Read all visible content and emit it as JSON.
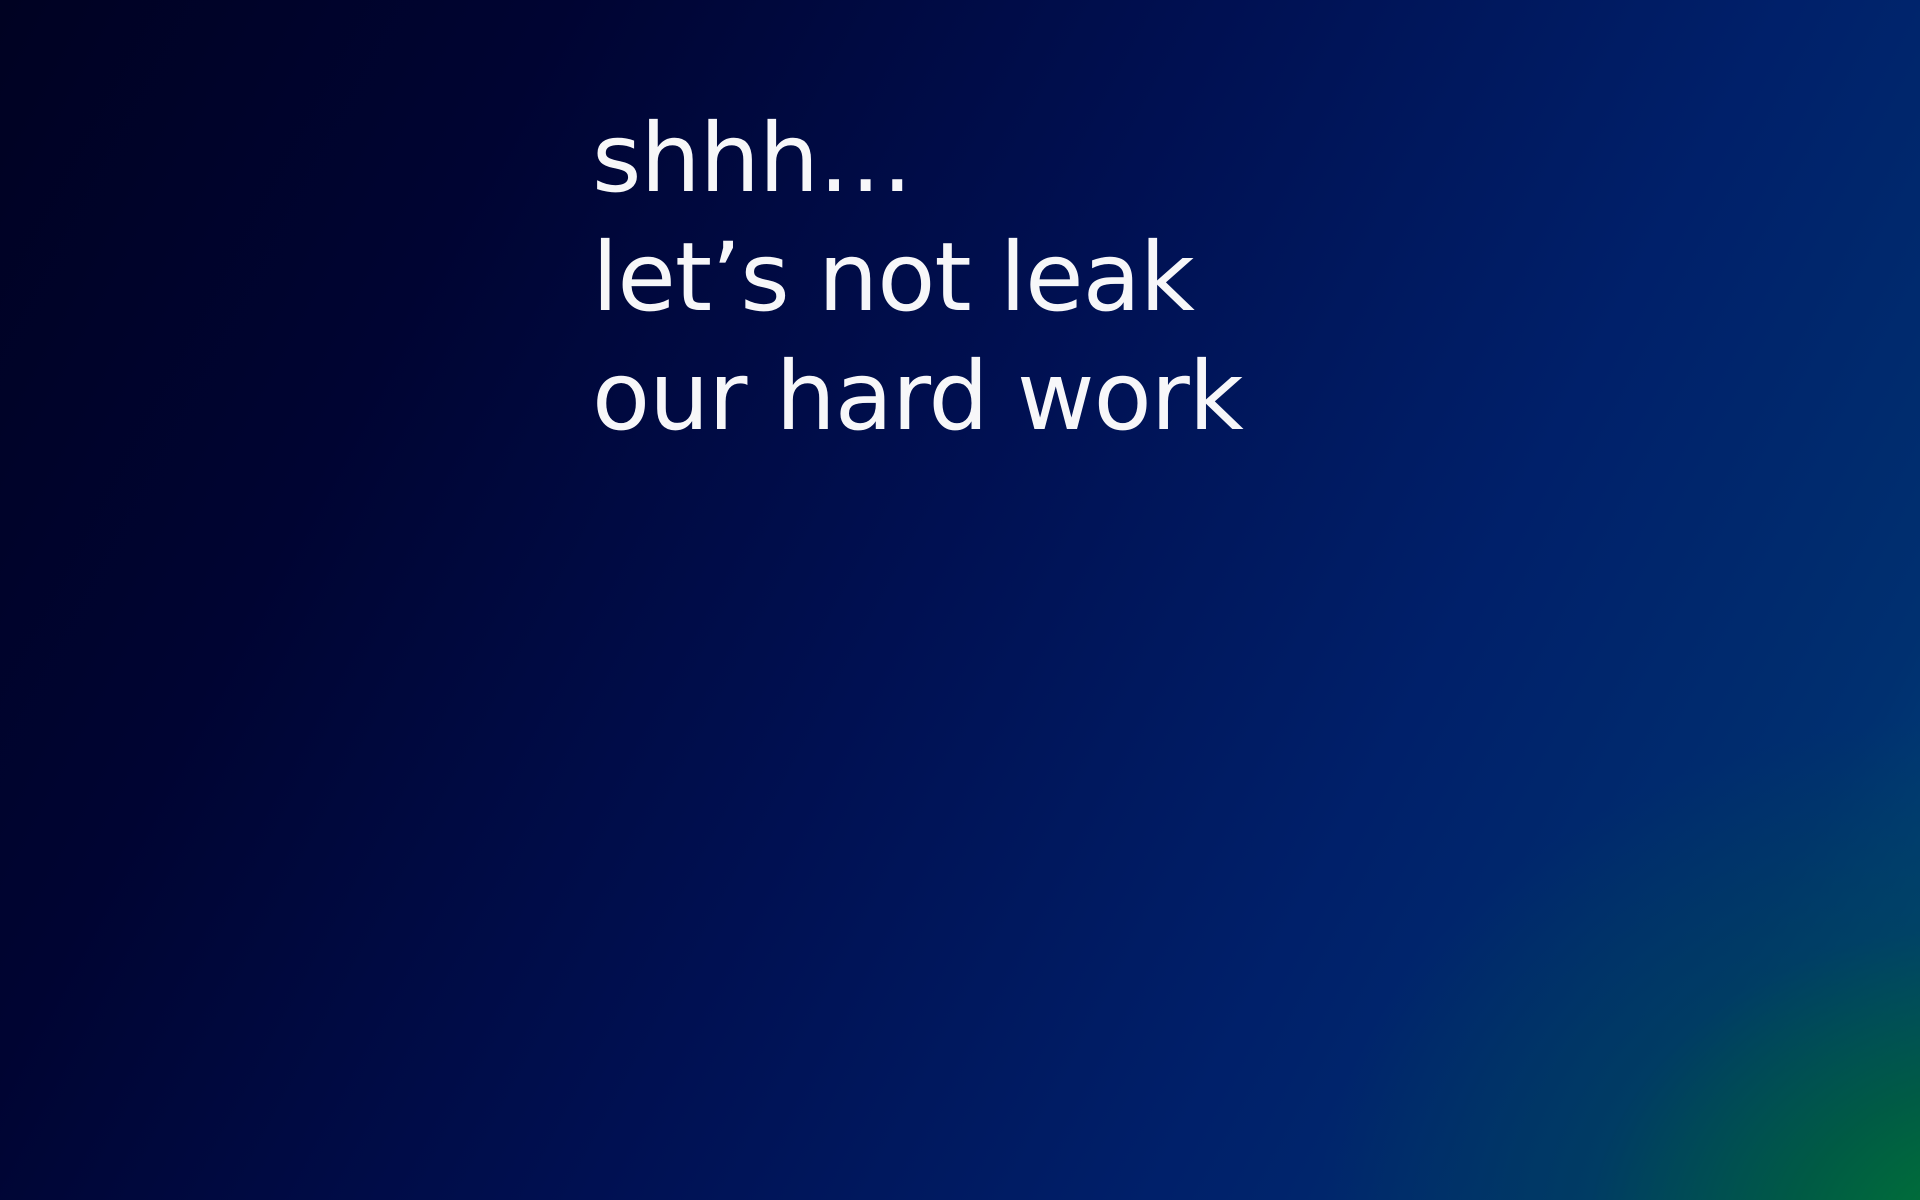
{
  "screen": {
    "background_colors": [
      "#000222",
      "#001052",
      "#00206a",
      "#006a3a"
    ],
    "text_color": "#ffffff"
  },
  "message": {
    "line1": "shhh…",
    "line2": "let’s not leak",
    "line3": "our hard work"
  }
}
